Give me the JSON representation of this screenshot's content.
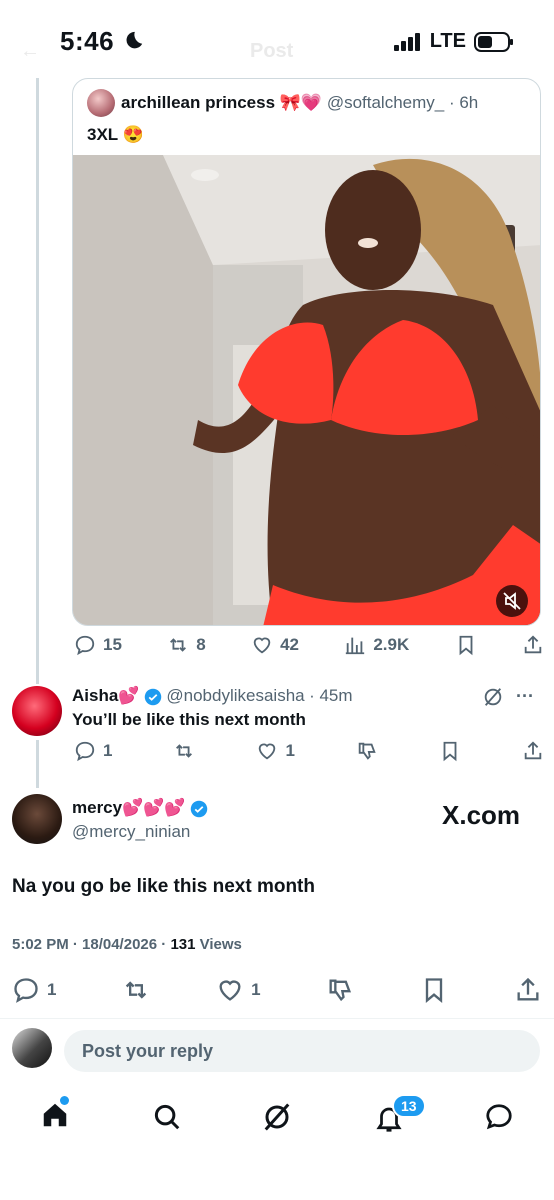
{
  "status": {
    "time": "5:46",
    "network": "LTE"
  },
  "header": {
    "title": "Post"
  },
  "quoted_post": {
    "name": "archillean princess 🎀💗",
    "handle": "@softalchemy_",
    "age": "· 6h",
    "text": "3XL 😍",
    "stats": {
      "replies": "15",
      "reposts": "8",
      "likes": "42",
      "views": "2.9K"
    }
  },
  "reply_1": {
    "name": "Aisha💕",
    "handle": "@nobdylikesaisha",
    "age": "· 45m",
    "text": "You’ll be like this next month",
    "stats": {
      "replies": "1",
      "likes": "1"
    }
  },
  "main_post": {
    "name": "mercy💕💕💕",
    "handle": "@mercy_ninian",
    "watermark": "X.com",
    "text": "Na you go be like this next month",
    "time": "5:02 PM · 18/04/2026 · ",
    "views_count": "131",
    "views_label": " Views",
    "stats": {
      "replies": "1",
      "likes": "1"
    }
  },
  "reply_bar": {
    "placeholder": "Post your reply"
  },
  "tabbar": {
    "notifications_badge": "13"
  },
  "colors": {
    "accent": "#1d9bf0",
    "muted": "#536471",
    "text": "#0f1419"
  }
}
